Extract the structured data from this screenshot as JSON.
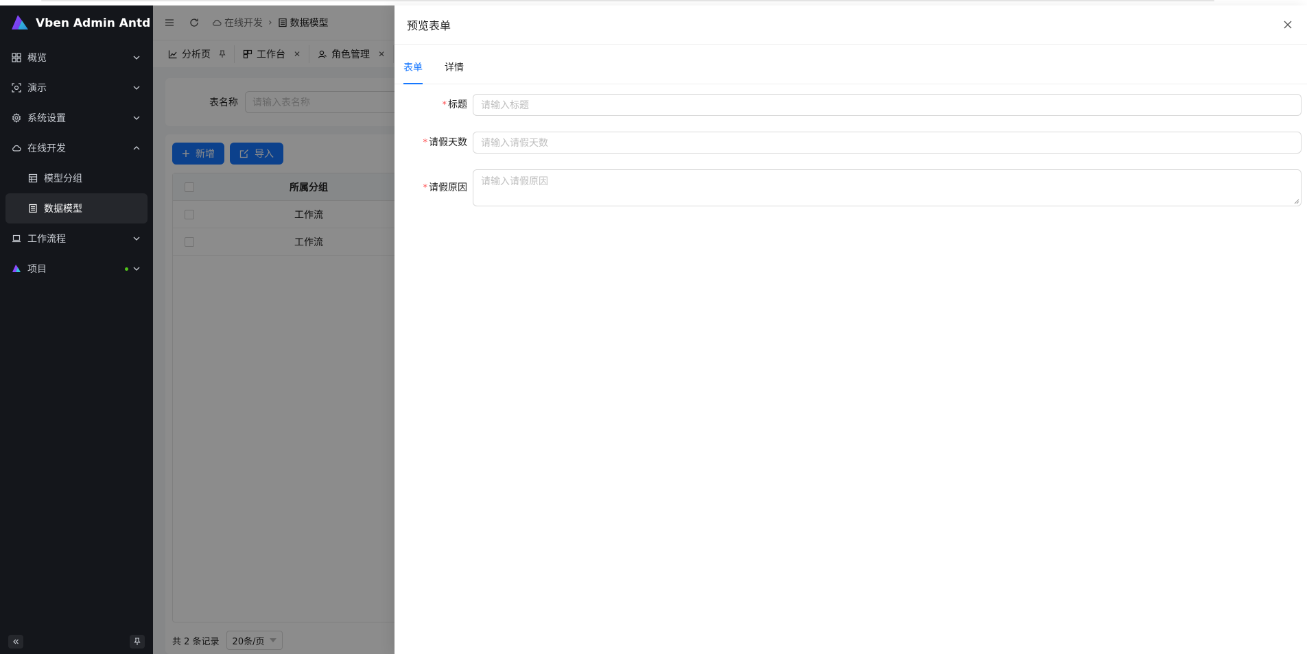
{
  "app": {
    "title": "Vben Admin Antd"
  },
  "sidebar": {
    "items": [
      {
        "label": "概览",
        "icon": "dashboard-icon"
      },
      {
        "label": "演示",
        "icon": "demo-icon"
      },
      {
        "label": "系统设置",
        "icon": "gear-icon"
      },
      {
        "label": "在线开发",
        "icon": "cloud-icon",
        "expanded": true,
        "children": [
          {
            "label": "模型分组",
            "icon": "table-icon"
          },
          {
            "label": "数据模型",
            "icon": "list-icon",
            "active": true
          }
        ]
      },
      {
        "label": "工作流程",
        "icon": "laptop-icon"
      },
      {
        "label": "项目",
        "icon": "project-logo-icon",
        "dot": true
      }
    ]
  },
  "header": {
    "breadcrumb": [
      {
        "label": "在线开发",
        "icon": "cloud-icon"
      },
      {
        "label": "数据模型",
        "icon": "list-icon"
      }
    ]
  },
  "tabs": [
    {
      "label": "分析页",
      "icon": "chart-icon",
      "pinned": true
    },
    {
      "label": "工作台",
      "icon": "workbench-icon"
    },
    {
      "label": "角色管理",
      "icon": "user-role-icon"
    }
  ],
  "search": {
    "label": "表名称",
    "placeholder": "请输入表名称"
  },
  "toolbar": {
    "add_label": "新增",
    "import_label": "导入"
  },
  "table": {
    "columns": [
      "所属分组"
    ],
    "rows": [
      {
        "group": "工作流"
      },
      {
        "group": "工作流"
      }
    ]
  },
  "pager": {
    "total": "共 2 条记录",
    "page_size": "20条/页"
  },
  "drawer": {
    "title": "预览表单",
    "tabs": [
      {
        "label": "表单",
        "active": true
      },
      {
        "label": "详情"
      }
    ],
    "fields": [
      {
        "label": "标题",
        "placeholder": "请输入标题",
        "required": true,
        "type": "input"
      },
      {
        "label": "请假天数",
        "placeholder": "请输入请假天数",
        "required": true,
        "type": "input"
      },
      {
        "label": "请假原因",
        "placeholder": "请输入请假原因",
        "required": true,
        "type": "textarea"
      }
    ]
  },
  "colors": {
    "primary": "#1677ff",
    "sidebar_bg": "#14161b",
    "required": "#ff4d4f"
  }
}
